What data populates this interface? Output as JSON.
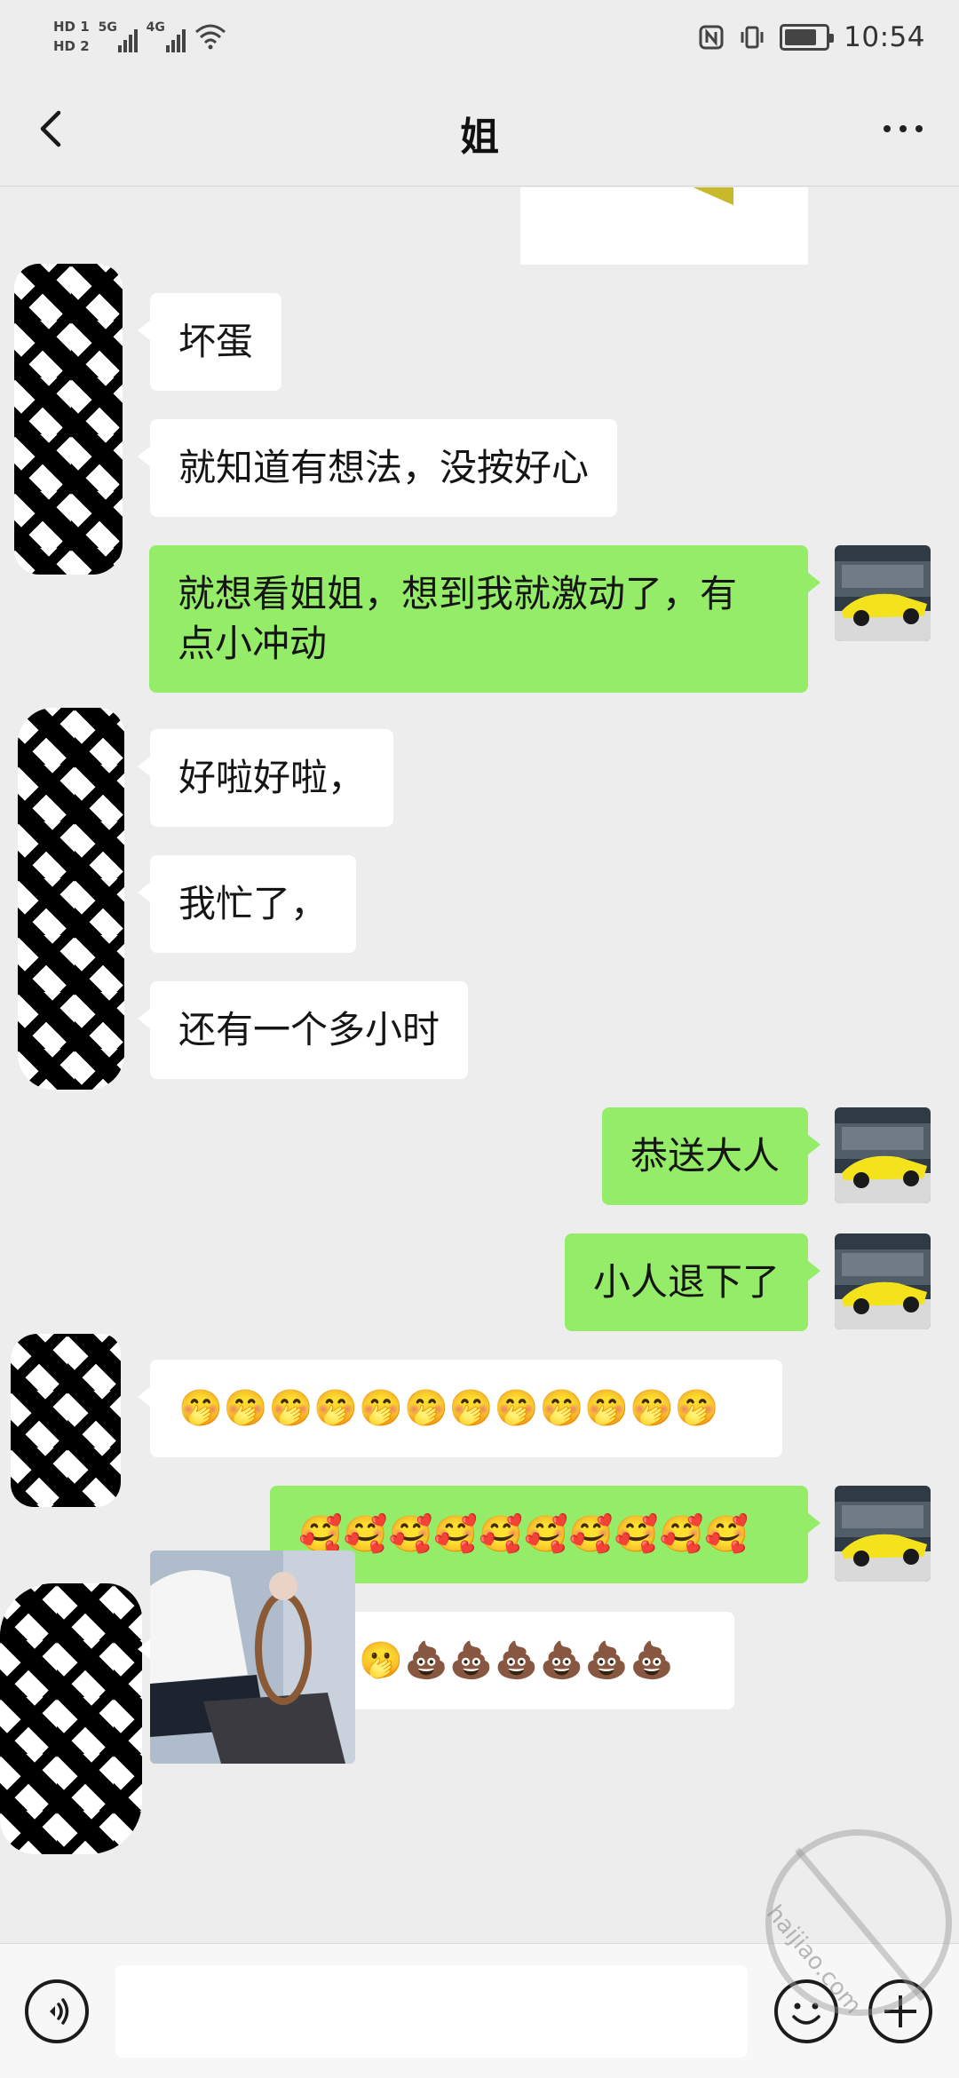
{
  "status_bar": {
    "sim1": "HD 1",
    "sim2": "HD 2",
    "net1": "5G",
    "net2": "4G",
    "time": "10:54",
    "battery_level": 0.8
  },
  "header": {
    "title": "姐"
  },
  "messages": [
    {
      "side": "in",
      "text": "坏蛋"
    },
    {
      "side": "in",
      "text": "就知道有想法，没按好心"
    },
    {
      "side": "out",
      "text": "就想看姐姐，想到我就激动了，有\n点小冲动"
    },
    {
      "side": "in",
      "text": "好啦好啦，"
    },
    {
      "side": "in",
      "text": "我忙了，"
    },
    {
      "side": "in",
      "text": "还有一个多小时"
    },
    {
      "side": "out",
      "text": "恭送大人"
    },
    {
      "side": "out",
      "text": "小人退下了"
    },
    {
      "side": "in",
      "text": "🤭🤭🤭🤭🤭🤭🤭🤭🤭🤭🤭🤭"
    },
    {
      "side": "out",
      "text": "🥰🥰🥰🥰🥰🥰🥰🥰🥰🥰"
    },
    {
      "side": "in",
      "text": "🫢🫢🫢🫢🫢💩💩💩💩💩💩"
    }
  ],
  "input": {
    "value": "",
    "placeholder": ""
  },
  "icons": {
    "back": "chevron-left-icon",
    "more": "more-dots-icon",
    "voice": "voice-icon",
    "emoji": "emoji-icon",
    "plus": "plus-icon"
  },
  "watermark": "haijiao.com",
  "colors": {
    "background": "#ededed",
    "bubble_in": "#ffffff",
    "bubble_out": "#95ec69",
    "input_bar": "#f7f7f7"
  }
}
